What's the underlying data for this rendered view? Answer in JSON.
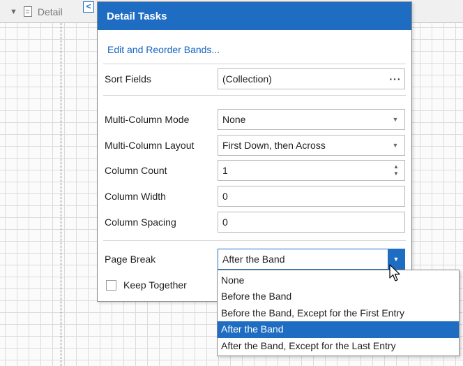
{
  "band": {
    "caption": "Detail",
    "collapse_glyph": "▼",
    "smart_tag_glyph": "<"
  },
  "panel": {
    "title": "Detail Tasks",
    "link": "Edit and Reorder Bands...",
    "rows": {
      "sort_fields": {
        "label": "Sort Fields",
        "value": "(Collection)",
        "button": "···"
      },
      "multi_column_mode": {
        "label": "Multi-Column Mode",
        "value": "None"
      },
      "multi_column_layout": {
        "label": "Multi-Column Layout",
        "value": "First Down, then Across"
      },
      "column_count": {
        "label": "Column Count",
        "value": "1"
      },
      "column_width": {
        "label": "Column Width",
        "value": "0"
      },
      "column_spacing": {
        "label": "Column Spacing",
        "value": "0"
      },
      "page_break": {
        "label": "Page Break",
        "value": "After the Band"
      },
      "keep_together": {
        "label": "Keep Together",
        "checked": false
      }
    }
  },
  "page_break_options": [
    "None",
    "Before the Band",
    "Before the Band, Except for the First Entry",
    "After the Band",
    "After the Band, Except for the Last Entry"
  ],
  "selected_option": "After the Band",
  "colors": {
    "accent": "#1f6dc2",
    "link": "#1565c0"
  },
  "icons": {
    "dropdown_arrow": "▼",
    "spin_up": "▲",
    "spin_down": "▼"
  }
}
